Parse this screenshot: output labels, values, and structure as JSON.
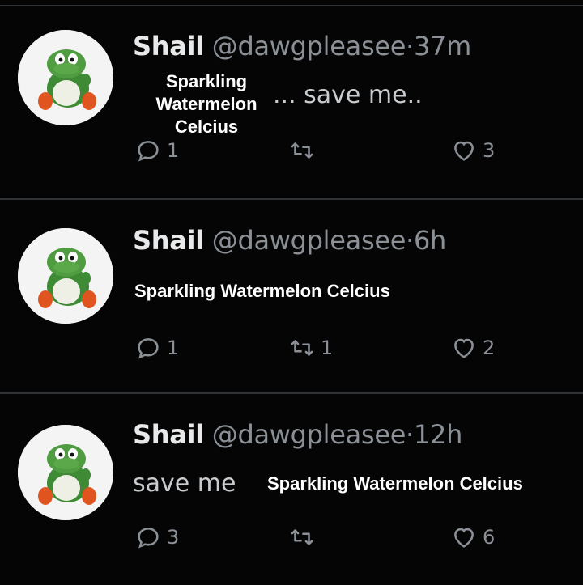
{
  "tweets": [
    {
      "name": "Shail",
      "handle": "@dawgpleasee",
      "separator": "·",
      "time": "37m",
      "overlay_text_lines": [
        "Sparkling",
        "Watermelon",
        "Celcius"
      ],
      "text": "... save me..",
      "replies": "1",
      "retweets": "",
      "likes": "3"
    },
    {
      "name": "Shail",
      "handle": "@dawgpleasee",
      "separator": "·",
      "time": "6h",
      "overlay_text": "Sparkling Watermelon Celcius",
      "replies": "1",
      "retweets": "1",
      "likes": "2"
    },
    {
      "name": "Shail",
      "handle": "@dawgpleasee",
      "separator": "·",
      "time": "12h",
      "text": "save me",
      "overlay_text": "Sparkling Watermelon Celcius",
      "replies": "3",
      "retweets": "",
      "likes": "6"
    }
  ],
  "icons": {
    "avatar": "yoshi-avatar-icon",
    "reply": "reply-icon",
    "retweet": "retweet-icon",
    "like": "heart-icon"
  },
  "colors": {
    "background": "#050505",
    "name": "#e7e9ea",
    "muted": "#8b9096",
    "overlay": "#ffffff"
  }
}
